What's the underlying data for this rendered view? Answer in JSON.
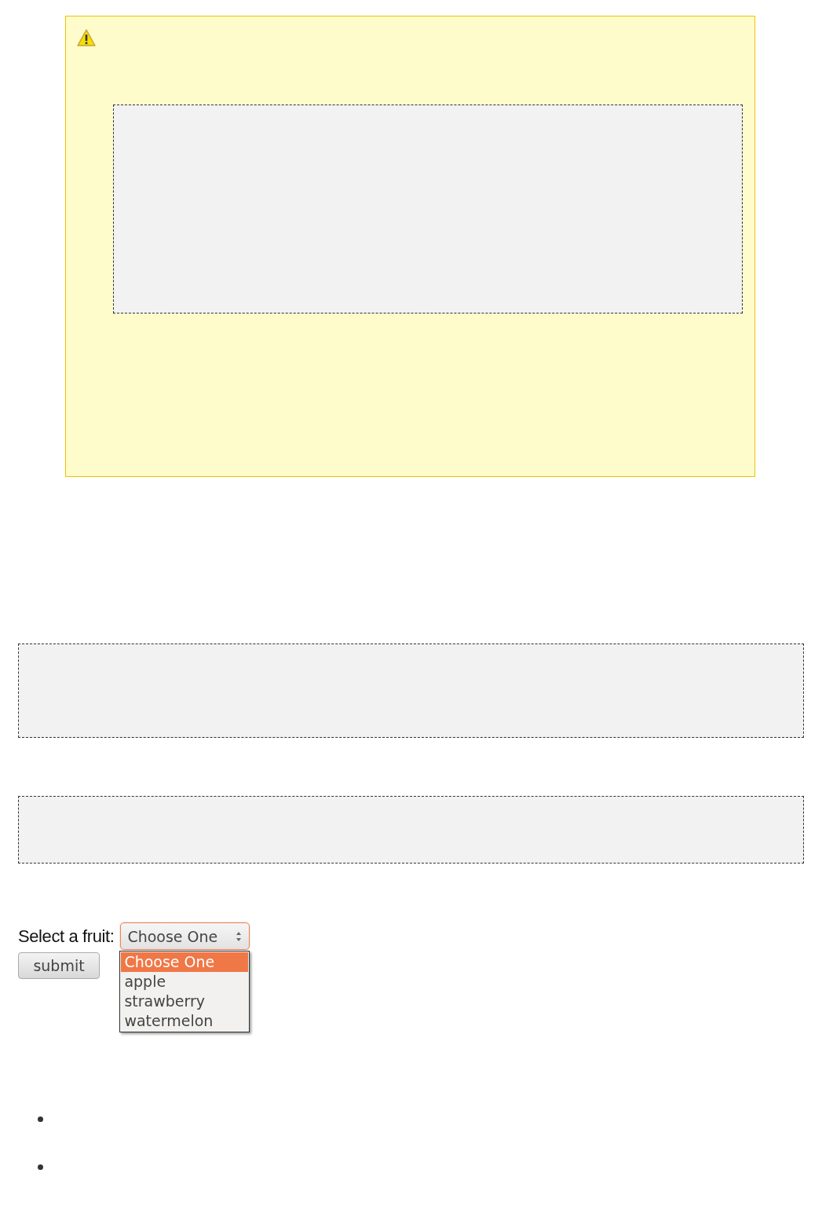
{
  "warning": {
    "kind": "warning"
  },
  "code_blocks": [
    {
      "kind": "code"
    },
    {
      "kind": "code"
    }
  ],
  "form": {
    "label": "Select a fruit:",
    "select": {
      "value": "Choose One",
      "expanded": true,
      "options": [
        {
          "label": "Choose One",
          "selected": true
        },
        {
          "label": "apple",
          "selected": false
        },
        {
          "label": "strawberry",
          "selected": false
        },
        {
          "label": "watermelon",
          "selected": false
        }
      ]
    },
    "submit": "submit"
  },
  "list": [
    {
      "kind": "bullet"
    },
    {
      "kind": "bullet"
    }
  ]
}
